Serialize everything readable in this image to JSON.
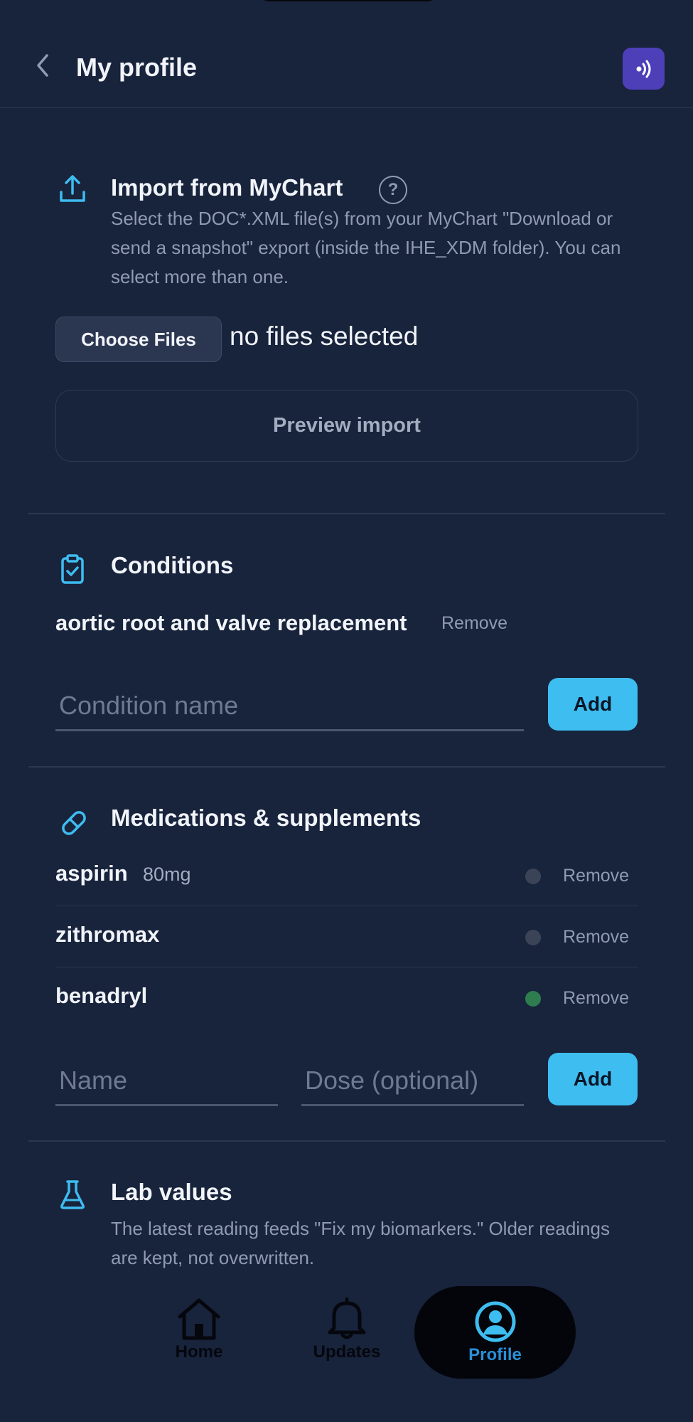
{
  "header": {
    "title": "My profile"
  },
  "import": {
    "title": "Import from MyChart",
    "help_glyph": "?",
    "description": "Select the DOC*.XML file(s) from your MyChart \"Download or send a snapshot\" export (inside the IHE_XDM folder). You can select more than one.",
    "choose_files_label": "Choose Files",
    "file_status": "no files selected",
    "preview_label": "Preview import"
  },
  "conditions": {
    "title": "Conditions",
    "items": [
      {
        "name": "aortic root and valve replacement",
        "remove_label": "Remove"
      }
    ],
    "input_placeholder": "Condition name",
    "add_label": "Add"
  },
  "medications": {
    "title": "Medications & supplements",
    "items": [
      {
        "name": "aspirin",
        "dose": "80mg",
        "status_color": "#3b4457",
        "remove_label": "Remove"
      },
      {
        "name": "zithromax",
        "dose": "",
        "status_color": "#3b4457",
        "remove_label": "Remove"
      },
      {
        "name": "benadryl",
        "dose": "",
        "status_color": "#2e7d4f",
        "remove_label": "Remove"
      }
    ],
    "name_placeholder": "Name",
    "dose_placeholder": "Dose (optional)",
    "add_label": "Add"
  },
  "labs": {
    "title": "Lab values",
    "description": "The latest reading feeds \"Fix my biomarkers.\" Older readings are kept, not overwritten."
  },
  "nav": {
    "items": [
      {
        "label": "Home",
        "icon": "home-icon",
        "active": false
      },
      {
        "label": "Updates",
        "icon": "bell-icon",
        "active": false
      },
      {
        "label": "Profile",
        "icon": "profile-icon",
        "active": true
      }
    ]
  },
  "colors": {
    "background": "#18233c",
    "accent": "#3ebdf0",
    "voice_button": "#4d3fb8",
    "nav_inactive": "#05070d",
    "nav_active": "#2a8fd6"
  },
  "icons": [
    "back-chevron-icon",
    "voice-icon",
    "upload-icon",
    "help-icon",
    "clipboard-check-icon",
    "pill-icon",
    "flask-icon"
  ]
}
